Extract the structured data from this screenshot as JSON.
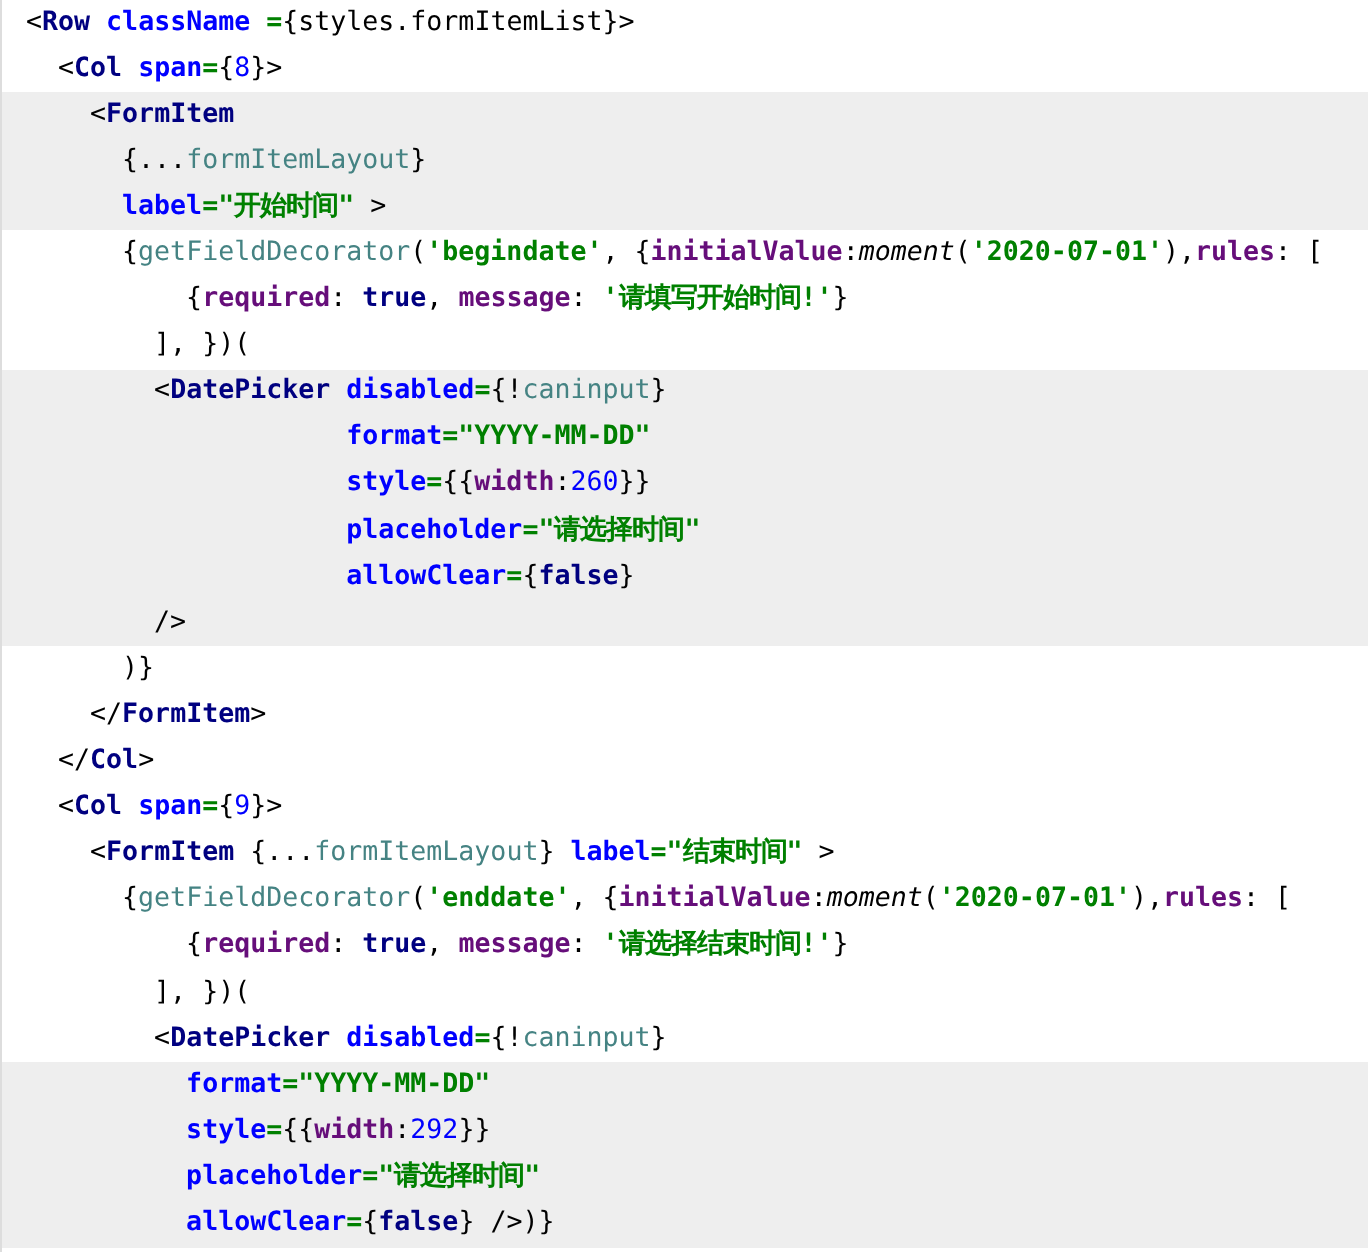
{
  "editor": {
    "lines": [
      {
        "highlighted": false,
        "tokens": [
          {
            "text": " <",
            "kind": "p"
          },
          {
            "text": "Row",
            "kind": "tag"
          },
          {
            "text": " className",
            "kind": "attr"
          },
          {
            "text": " =",
            "kind": "op"
          },
          {
            "text": "{styles.formItemList}",
            "kind": "p"
          },
          {
            "text": ">",
            "kind": "p"
          }
        ]
      },
      {
        "highlighted": false,
        "tokens": [
          {
            "text": "   <",
            "kind": "p"
          },
          {
            "text": "Col",
            "kind": "tag"
          },
          {
            "text": " span",
            "kind": "attr"
          },
          {
            "text": "=",
            "kind": "op"
          },
          {
            "text": "{",
            "kind": "p"
          },
          {
            "text": "8",
            "kind": "num"
          },
          {
            "text": "}>",
            "kind": "p"
          }
        ]
      },
      {
        "highlighted": true,
        "tokens": [
          {
            "text": "     <",
            "kind": "p"
          },
          {
            "text": "FormItem",
            "kind": "tag"
          }
        ]
      },
      {
        "highlighted": true,
        "tokens": [
          {
            "text": "       {...",
            "kind": "p"
          },
          {
            "text": "formItemLayout",
            "kind": "ident"
          },
          {
            "text": "}",
            "kind": "p"
          }
        ]
      },
      {
        "highlighted": true,
        "tokens": [
          {
            "text": "       label",
            "kind": "attr"
          },
          {
            "text": "=",
            "kind": "op"
          },
          {
            "text": "\"开始时间\"",
            "kind": "str"
          },
          {
            "text": " >",
            "kind": "p"
          }
        ]
      },
      {
        "highlighted": false,
        "tokens": [
          {
            "text": "       {",
            "kind": "p"
          },
          {
            "text": "getFieldDecorator",
            "kind": "ident"
          },
          {
            "text": "(",
            "kind": "p"
          },
          {
            "text": "'begindate'",
            "kind": "str"
          },
          {
            "text": ", {",
            "kind": "p"
          },
          {
            "text": "initialValue",
            "kind": "key"
          },
          {
            "text": ":",
            "kind": "p"
          },
          {
            "text": "moment",
            "kind": "fn"
          },
          {
            "text": "(",
            "kind": "p"
          },
          {
            "text": "'2020-07-01'",
            "kind": "str"
          },
          {
            "text": "),",
            "kind": "p"
          },
          {
            "text": "rules",
            "kind": "key"
          },
          {
            "text": ": [",
            "kind": "p"
          }
        ]
      },
      {
        "highlighted": false,
        "tokens": [
          {
            "text": "           {",
            "kind": "p"
          },
          {
            "text": "required",
            "kind": "key"
          },
          {
            "text": ": ",
            "kind": "p"
          },
          {
            "text": "true",
            "kind": "kw"
          },
          {
            "text": ", ",
            "kind": "p"
          },
          {
            "text": "message",
            "kind": "key"
          },
          {
            "text": ": ",
            "kind": "p"
          },
          {
            "text": "'请填写开始时间!'",
            "kind": "str"
          },
          {
            "text": "}",
            "kind": "p"
          }
        ]
      },
      {
        "highlighted": false,
        "tokens": [
          {
            "text": "         ], })(",
            "kind": "p"
          }
        ]
      },
      {
        "highlighted": true,
        "tokens": [
          {
            "text": "         <",
            "kind": "p"
          },
          {
            "text": "DatePicker",
            "kind": "tag"
          },
          {
            "text": " disabled",
            "kind": "attr"
          },
          {
            "text": "=",
            "kind": "op"
          },
          {
            "text": "{!",
            "kind": "p"
          },
          {
            "text": "caninput",
            "kind": "ident"
          },
          {
            "text": "}",
            "kind": "p"
          }
        ]
      },
      {
        "highlighted": true,
        "tokens": [
          {
            "text": "                     format",
            "kind": "attr"
          },
          {
            "text": "=",
            "kind": "op"
          },
          {
            "text": "\"YYYY-MM-DD\"",
            "kind": "str"
          }
        ]
      },
      {
        "highlighted": true,
        "tokens": [
          {
            "text": "                     style",
            "kind": "attr"
          },
          {
            "text": "=",
            "kind": "op"
          },
          {
            "text": "{{",
            "kind": "p"
          },
          {
            "text": "width",
            "kind": "key"
          },
          {
            "text": ":",
            "kind": "p"
          },
          {
            "text": "260",
            "kind": "num"
          },
          {
            "text": "}}",
            "kind": "p"
          }
        ]
      },
      {
        "highlighted": true,
        "tokens": [
          {
            "text": "                     placeholder",
            "kind": "attr"
          },
          {
            "text": "=",
            "kind": "op"
          },
          {
            "text": "\"请选择时间\"",
            "kind": "str"
          }
        ]
      },
      {
        "highlighted": true,
        "tokens": [
          {
            "text": "                     allowClear",
            "kind": "attr"
          },
          {
            "text": "=",
            "kind": "op"
          },
          {
            "text": "{",
            "kind": "p"
          },
          {
            "text": "false",
            "kind": "kw"
          },
          {
            "text": "}",
            "kind": "p"
          }
        ]
      },
      {
        "highlighted": true,
        "tokens": [
          {
            "text": "         />",
            "kind": "p"
          }
        ]
      },
      {
        "highlighted": false,
        "tokens": [
          {
            "text": "       )}",
            "kind": "p"
          }
        ]
      },
      {
        "highlighted": false,
        "tokens": [
          {
            "text": "     </",
            "kind": "p"
          },
          {
            "text": "FormItem",
            "kind": "tag"
          },
          {
            "text": ">",
            "kind": "p"
          }
        ]
      },
      {
        "highlighted": false,
        "tokens": [
          {
            "text": "   </",
            "kind": "p"
          },
          {
            "text": "Col",
            "kind": "tag"
          },
          {
            "text": ">",
            "kind": "p"
          }
        ]
      },
      {
        "highlighted": false,
        "tokens": [
          {
            "text": "   <",
            "kind": "p"
          },
          {
            "text": "Col",
            "kind": "tag"
          },
          {
            "text": " span",
            "kind": "attr"
          },
          {
            "text": "=",
            "kind": "op"
          },
          {
            "text": "{",
            "kind": "p"
          },
          {
            "text": "9",
            "kind": "num"
          },
          {
            "text": "}>",
            "kind": "p"
          }
        ]
      },
      {
        "highlighted": false,
        "tokens": [
          {
            "text": "     <",
            "kind": "p"
          },
          {
            "text": "FormItem",
            "kind": "tag"
          },
          {
            "text": " {...",
            "kind": "p"
          },
          {
            "text": "formItemLayout",
            "kind": "ident"
          },
          {
            "text": "}",
            "kind": "p"
          },
          {
            "text": " label",
            "kind": "attr"
          },
          {
            "text": "=",
            "kind": "op"
          },
          {
            "text": "\"结束时间\"",
            "kind": "str"
          },
          {
            "text": " >",
            "kind": "p"
          }
        ]
      },
      {
        "highlighted": false,
        "tokens": [
          {
            "text": "       {",
            "kind": "p"
          },
          {
            "text": "getFieldDecorator",
            "kind": "ident"
          },
          {
            "text": "(",
            "kind": "p"
          },
          {
            "text": "'enddate'",
            "kind": "str"
          },
          {
            "text": ", {",
            "kind": "p"
          },
          {
            "text": "initialValue",
            "kind": "key"
          },
          {
            "text": ":",
            "kind": "p"
          },
          {
            "text": "moment",
            "kind": "fn"
          },
          {
            "text": "(",
            "kind": "p"
          },
          {
            "text": "'2020-07-01'",
            "kind": "str"
          },
          {
            "text": "),",
            "kind": "p"
          },
          {
            "text": "rules",
            "kind": "key"
          },
          {
            "text": ": [",
            "kind": "p"
          }
        ]
      },
      {
        "highlighted": false,
        "tokens": [
          {
            "text": "           {",
            "kind": "p"
          },
          {
            "text": "required",
            "kind": "key"
          },
          {
            "text": ": ",
            "kind": "p"
          },
          {
            "text": "true",
            "kind": "kw"
          },
          {
            "text": ", ",
            "kind": "p"
          },
          {
            "text": "message",
            "kind": "key"
          },
          {
            "text": ": ",
            "kind": "p"
          },
          {
            "text": "'请选择结束时间!'",
            "kind": "str"
          },
          {
            "text": "}",
            "kind": "p"
          }
        ]
      },
      {
        "highlighted": false,
        "tokens": [
          {
            "text": "         ], })(",
            "kind": "p"
          }
        ]
      },
      {
        "highlighted": false,
        "tokens": [
          {
            "text": "         <",
            "kind": "p"
          },
          {
            "text": "DatePicker",
            "kind": "tag"
          },
          {
            "text": " disabled",
            "kind": "attr"
          },
          {
            "text": "=",
            "kind": "op"
          },
          {
            "text": "{!",
            "kind": "p"
          },
          {
            "text": "caninput",
            "kind": "ident"
          },
          {
            "text": "}",
            "kind": "p"
          }
        ]
      },
      {
        "highlighted": true,
        "tokens": [
          {
            "text": "           format",
            "kind": "attr"
          },
          {
            "text": "=",
            "kind": "op"
          },
          {
            "text": "\"YYYY-MM-DD\"",
            "kind": "str"
          }
        ]
      },
      {
        "highlighted": true,
        "tokens": [
          {
            "text": "           style",
            "kind": "attr"
          },
          {
            "text": "=",
            "kind": "op"
          },
          {
            "text": "{{",
            "kind": "p"
          },
          {
            "text": "width",
            "kind": "key"
          },
          {
            "text": ":",
            "kind": "p"
          },
          {
            "text": "292",
            "kind": "num"
          },
          {
            "text": "}}",
            "kind": "p"
          }
        ]
      },
      {
        "highlighted": true,
        "tokens": [
          {
            "text": "           placeholder",
            "kind": "attr"
          },
          {
            "text": "=",
            "kind": "op"
          },
          {
            "text": "\"请选择时间\"",
            "kind": "str"
          }
        ]
      },
      {
        "highlighted": true,
        "tokens": [
          {
            "text": "           allowClear",
            "kind": "attr"
          },
          {
            "text": "=",
            "kind": "op"
          },
          {
            "text": "{",
            "kind": "p"
          },
          {
            "text": "false",
            "kind": "kw"
          },
          {
            "text": "} />)}",
            "kind": "p"
          }
        ]
      }
    ]
  }
}
